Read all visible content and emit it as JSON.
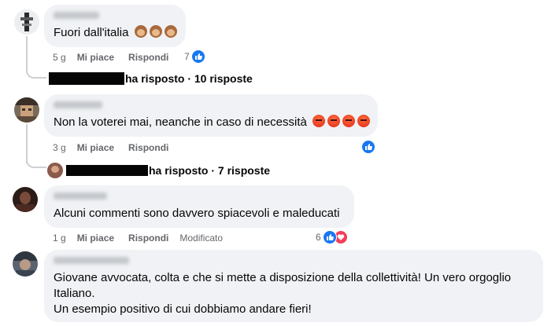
{
  "comments": [
    {
      "text": "Fuori dall'italia",
      "reaction_emojis": [
        "see-no-evil-monkey",
        "see-no-evil-monkey",
        "see-no-evil-monkey"
      ],
      "time": "5 g",
      "like_label": "Mi piace",
      "reply_label": "Rispondi",
      "reaction_count": "7",
      "reactions": [
        "like"
      ],
      "replies_text": "ha risposto · 10 risposte"
    },
    {
      "text": "Non la voterei mai, neanche in caso di necessità",
      "reaction_emojis": [
        "angry",
        "angry",
        "angry",
        "angry"
      ],
      "time": "3 g",
      "like_label": "Mi piace",
      "reply_label": "Rispondi",
      "reaction_count": "",
      "reactions": [
        "like"
      ],
      "replies_text": "ha risposto · 7 risposte"
    },
    {
      "text": "Alcuni commenti sono davvero spiacevoli e maleducati",
      "time": "1 g",
      "like_label": "Mi piace",
      "reply_label": "Rispondi",
      "edited_label": "Modificato",
      "reaction_count": "6",
      "reactions": [
        "like",
        "love"
      ]
    },
    {
      "text_lines": [
        "Giovane avvocata, colta e che si mette a disposizione della collettività! Un vero orgoglio",
        "Italiano.",
        "Un esempio positivo di cui dobbiamo andare fieri!"
      ]
    }
  ],
  "colors": {
    "bubble": "#f0f2f5",
    "meta_text": "#65676b",
    "like_blue": "#1877f2",
    "love_red": "#f33e58",
    "thread_line": "#ced0d4"
  }
}
